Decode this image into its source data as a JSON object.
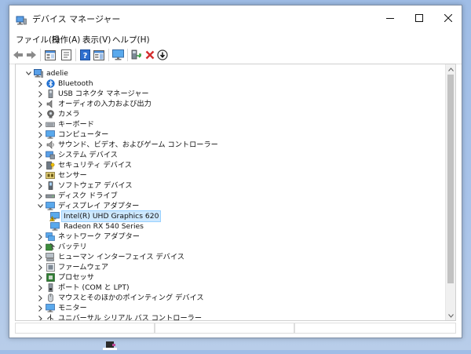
{
  "window": {
    "title": "デバイス マネージャー",
    "buttons": [
      "minimize",
      "maximize",
      "close"
    ]
  },
  "menu": [
    {
      "label": "ファイル(F)"
    },
    {
      "label": "操作(A)"
    },
    {
      "label": "表示(V)"
    },
    {
      "label": "ヘルプ(H)"
    }
  ],
  "toolbar": {
    "icons": [
      "back-arrow-icon",
      "forward-arrow-icon",
      "device-view-icon",
      "properties-sheet-icon",
      "help-icon",
      "action-pane-icon",
      "monitor-scan-icon",
      "update-driver-icon",
      "uninstall-x-icon",
      "rollback-download-icon"
    ]
  },
  "tree": {
    "root": {
      "label": "adelie"
    },
    "items": [
      {
        "label": "Bluetooth",
        "icon": "bluetooth-icon",
        "expanded": false
      },
      {
        "label": "USB コネクタ マネージャー",
        "icon": "usb-connector-icon",
        "expanded": false
      },
      {
        "label": "オーディオの入力および出力",
        "icon": "audio-io-icon",
        "expanded": false
      },
      {
        "label": "カメラ",
        "icon": "camera-icon",
        "expanded": false
      },
      {
        "label": "キーボード",
        "icon": "keyboard-icon",
        "expanded": false
      },
      {
        "label": "コンピューター",
        "icon": "computer-icon",
        "expanded": false
      },
      {
        "label": "サウンド、ビデオ、およびゲーム コントローラー",
        "icon": "sound-icon",
        "expanded": false
      },
      {
        "label": "システム デバイス",
        "icon": "system-device-icon",
        "expanded": false
      },
      {
        "label": "セキュリティ デバイス",
        "icon": "security-device-icon",
        "expanded": false
      },
      {
        "label": "センサー",
        "icon": "sensor-icon",
        "expanded": false
      },
      {
        "label": "ソフトウェア デバイス",
        "icon": "software-device-icon",
        "expanded": false
      },
      {
        "label": "ディスク ドライブ",
        "icon": "disk-drive-icon",
        "expanded": false
      },
      {
        "label": "ディスプレイ アダプター",
        "icon": "display-adapter-icon",
        "expanded": true,
        "children": [
          {
            "label": "Intel(R) UHD Graphics 620",
            "icon": "display-warning-icon",
            "selected": true
          },
          {
            "label": "Radeon RX 540 Series",
            "icon": "display-adapter-icon",
            "selected": false
          }
        ]
      },
      {
        "label": "ネットワーク アダプター",
        "icon": "network-adapter-icon",
        "expanded": false
      },
      {
        "label": "バッテリ",
        "icon": "battery-icon",
        "expanded": false
      },
      {
        "label": "ヒューマン インターフェイス デバイス",
        "icon": "hid-icon",
        "expanded": false
      },
      {
        "label": "ファームウェア",
        "icon": "firmware-icon",
        "expanded": false
      },
      {
        "label": "プロセッサ",
        "icon": "processor-icon",
        "expanded": false
      },
      {
        "label": "ポート (COM と LPT)",
        "icon": "port-icon",
        "expanded": false
      },
      {
        "label": "マウスとそのほかのポインティング デバイス",
        "icon": "mouse-icon",
        "expanded": false
      },
      {
        "label": "モニター",
        "icon": "monitor-icon",
        "expanded": false
      },
      {
        "label": "ユニバーサル シリアル バス コントローラー",
        "icon": "usb-controller-icon",
        "expanded": false
      }
    ]
  },
  "colors": {
    "selection_bg": "#cde8ff",
    "selection_border": "#99d1ff",
    "error_red": "#d32f2f",
    "warning_yellow": "#f2c200",
    "accent_blue": "#1f7ad1"
  }
}
